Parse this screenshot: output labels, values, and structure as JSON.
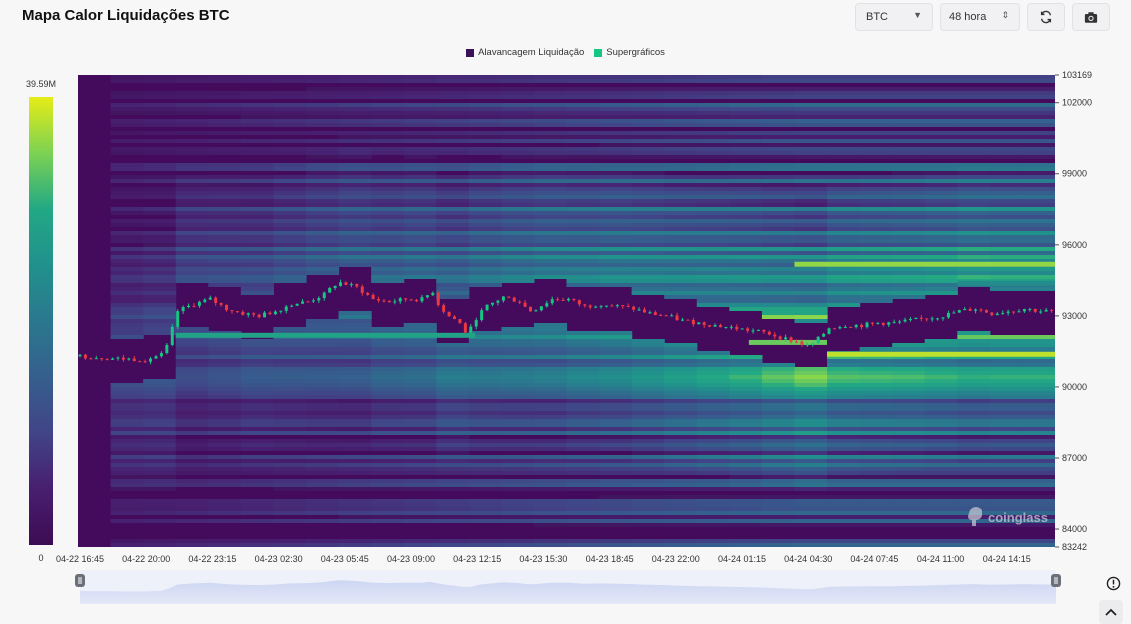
{
  "header": {
    "title": "Mapa Calor Liquidações BTC",
    "coin_select": "BTC",
    "range_select": "48 hora"
  },
  "icons": {
    "refresh": "refresh-icon",
    "camera": "camera-icon",
    "info": "info-icon",
    "collapse": "chevron-up-icon",
    "dropdown": "chevron-down-icon"
  },
  "chart_data": {
    "type": "heatmap",
    "legend": [
      {
        "name": "Alavancagem Liquidação",
        "color": "#3d1155"
      },
      {
        "name": "Supergráficos",
        "color": "#16c784"
      }
    ],
    "colorbar": {
      "max_label": "39.59M",
      "min_label": "0",
      "colors": [
        "#e6ec16",
        "#7cd253",
        "#22a884",
        "#21918c",
        "#2a788e",
        "#355f8d",
        "#414487",
        "#481f70",
        "#3d0b52"
      ]
    },
    "y_axis": {
      "min": 83242,
      "max": 103169,
      "ticks": [
        103169,
        102000,
        99000,
        96000,
        93000,
        90000,
        87000,
        84000,
        83242
      ]
    },
    "x_axis": {
      "ticks": [
        "04-22 16:45",
        "04-22 20:00",
        "04-22 23:15",
        "04-23 02:30",
        "04-23 05:45",
        "04-23 09:00",
        "04-23 12:15",
        "04-23 15:30",
        "04-23 18:45",
        "04-23 22:00",
        "04-24 01:15",
        "04-24 04:30",
        "04-24 07:45",
        "04-24 11:00",
        "04-24 14:15"
      ]
    },
    "price_path": [
      [
        0,
        91300
      ],
      [
        1,
        91200
      ],
      [
        2,
        91150
      ],
      [
        2.6,
        91400
      ],
      [
        3,
        93200
      ],
      [
        3.5,
        93500
      ],
      [
        4,
        93700
      ],
      [
        4.5,
        93300
      ],
      [
        5,
        93100
      ],
      [
        5.5,
        93000
      ],
      [
        6,
        93200
      ],
      [
        6.5,
        93500
      ],
      [
        7,
        93600
      ],
      [
        7.5,
        93900
      ],
      [
        7.8,
        94300
      ],
      [
        8,
        94400
      ],
      [
        8.5,
        94200
      ],
      [
        9,
        93700
      ],
      [
        9.5,
        93600
      ],
      [
        10,
        93700
      ],
      [
        10.5,
        93700
      ],
      [
        10.9,
        94100
      ],
      [
        11,
        93500
      ],
      [
        11.3,
        93000
      ],
      [
        11.6,
        92800
      ],
      [
        11.9,
        92200
      ],
      [
        12.2,
        93000
      ],
      [
        12.5,
        93400
      ],
      [
        13,
        93800
      ],
      [
        13.5,
        93600
      ],
      [
        13.8,
        93200
      ],
      [
        14,
        93300
      ],
      [
        14.5,
        93700
      ],
      [
        15,
        93700
      ],
      [
        15.5,
        93400
      ],
      [
        16,
        93500
      ],
      [
        16.5,
        93400
      ],
      [
        17,
        93300
      ],
      [
        17.5,
        93100
      ],
      [
        18,
        93000
      ],
      [
        18.5,
        92800
      ],
      [
        19,
        92700
      ],
      [
        19.5,
        92600
      ],
      [
        20,
        92500
      ],
      [
        20.5,
        92400
      ],
      [
        21,
        92300
      ],
      [
        21.5,
        92100
      ],
      [
        22,
        91900
      ],
      [
        22.4,
        91700
      ],
      [
        22.8,
        92200
      ],
      [
        23,
        92500
      ],
      [
        23.5,
        92600
      ],
      [
        24,
        92600
      ],
      [
        24.5,
        92700
      ],
      [
        25,
        92700
      ],
      [
        25.5,
        92800
      ],
      [
        26,
        92900
      ],
      [
        26.5,
        93000
      ],
      [
        27,
        93200
      ],
      [
        27.5,
        93300
      ],
      [
        28,
        93100
      ],
      [
        28.5,
        93200
      ],
      [
        29,
        93300
      ],
      [
        29.5,
        93200
      ],
      [
        29.9,
        93200
      ]
    ],
    "watermark": "coinglass"
  }
}
